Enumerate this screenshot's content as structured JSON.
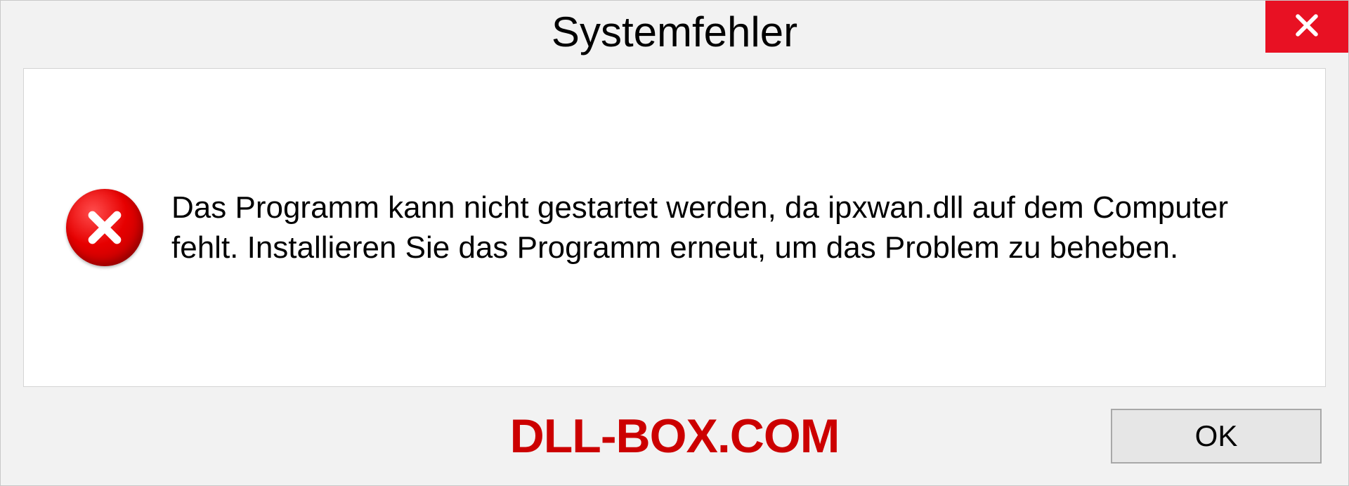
{
  "dialog": {
    "title": "Systemfehler",
    "message": "Das Programm kann nicht gestartet werden, da ipxwan.dll auf dem Computer fehlt. Installieren Sie das Programm erneut, um das Problem zu beheben.",
    "ok_label": "OK"
  },
  "watermark": "DLL-BOX.COM",
  "icons": {
    "close": "close-icon",
    "error": "error-circle-x-icon"
  },
  "colors": {
    "close_bg": "#e81123",
    "error_red": "#cc0000",
    "watermark": "#cc0000"
  }
}
